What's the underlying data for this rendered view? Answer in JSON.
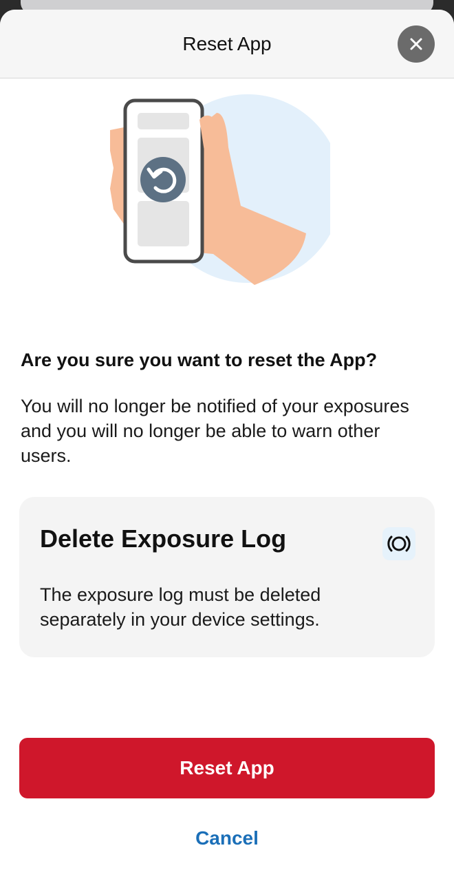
{
  "header": {
    "title": "Reset App",
    "close_icon": "close-icon"
  },
  "illustration": {
    "icon": "reset-icon"
  },
  "content": {
    "question": "Are you sure you want to reset the App?",
    "description": "You will no longer be notified of your exposures and you will no longer be able to warn other users."
  },
  "card": {
    "title": "Delete Exposure Log",
    "icon": "exposure-notification-icon",
    "text": "The exposure log must be deleted separately in your device settings."
  },
  "actions": {
    "reset_label": "Reset App",
    "cancel_label": "Cancel"
  },
  "colors": {
    "accent_red": "#cf172b",
    "link_blue": "#1b6fb8"
  }
}
